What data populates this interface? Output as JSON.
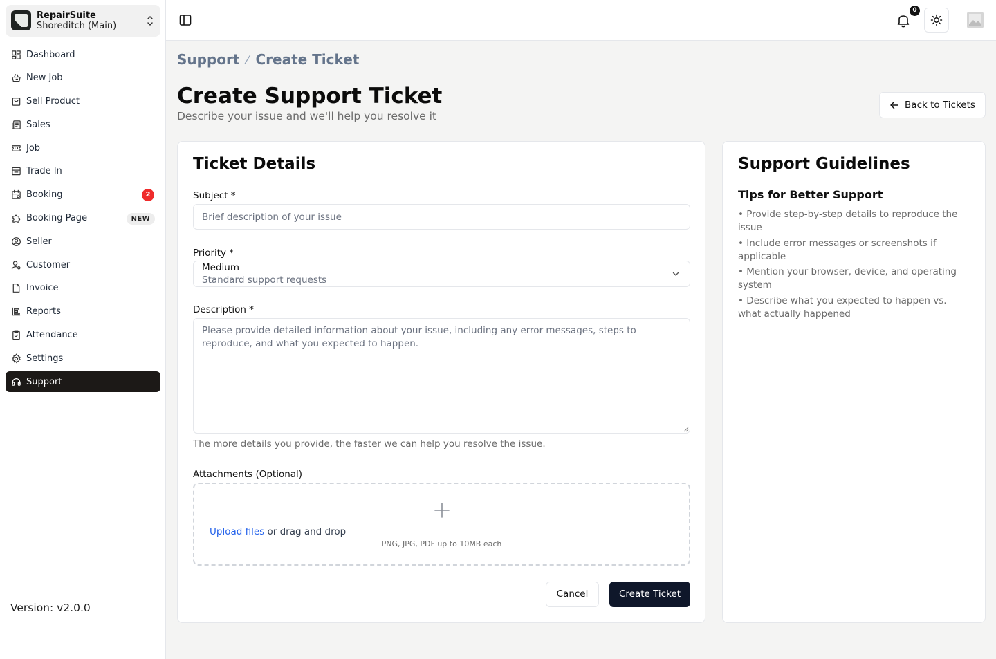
{
  "app": {
    "name": "RepairSuite",
    "branch": "Shoreditch (Main)"
  },
  "sidebar": {
    "items": [
      {
        "label": "Dashboard",
        "icon": "dashboard-icon"
      },
      {
        "label": "New Job",
        "icon": "basket-icon"
      },
      {
        "label": "Sell Product",
        "icon": "shopping-bag-icon"
      },
      {
        "label": "Sales",
        "icon": "receipt-icon"
      },
      {
        "label": "Job",
        "icon": "ticket-icon"
      },
      {
        "label": "Trade In",
        "icon": "archive-icon"
      },
      {
        "label": "Booking",
        "icon": "calendar-icon",
        "badge": "2"
      },
      {
        "label": "Booking Page",
        "icon": "puzzle-icon",
        "tag": "NEW"
      },
      {
        "label": "Seller",
        "icon": "user-circle-icon"
      },
      {
        "label": "Customer",
        "icon": "user-cog-icon"
      },
      {
        "label": "Invoice",
        "icon": "file-icon"
      },
      {
        "label": "Reports",
        "icon": "report-icon"
      },
      {
        "label": "Attendance",
        "icon": "clipboard-check-icon"
      },
      {
        "label": "Settings",
        "icon": "gear-icon"
      },
      {
        "label": "Support",
        "icon": "headset-icon",
        "active": true
      }
    ],
    "version": "Version: v2.0.0"
  },
  "topbar": {
    "notification_count": "0"
  },
  "breadcrumb": {
    "items": [
      "Support",
      "Create Ticket"
    ],
    "separator": "⁄"
  },
  "page": {
    "title": "Create Support Ticket",
    "subtitle": "Describe your issue and we'll help you resolve it",
    "back_label": "Back to Tickets"
  },
  "form": {
    "title": "Ticket Details",
    "subject_label": "Subject *",
    "subject_placeholder": "Brief description of your issue",
    "priority_label": "Priority *",
    "priority_value": "Medium",
    "priority_description": "Standard support requests",
    "description_label": "Description *",
    "description_placeholder": "Please provide detailed information about your issue, including any error messages, steps to reproduce, and what you expected to happen.",
    "description_hint": "The more details you provide, the faster we can help you resolve the issue.",
    "attachments_label": "Attachments (Optional)",
    "upload_link": "Upload files",
    "upload_text": " or drag and drop",
    "upload_note": "PNG, JPG, PDF up to 10MB each",
    "cancel_label": "Cancel",
    "submit_label": "Create Ticket"
  },
  "guidelines": {
    "title": "Support Guidelines",
    "subtitle": "Tips for Better Support",
    "tips": [
      "• Provide step-by-step details to reproduce the issue",
      "• Include error messages or screenshots if applicable",
      "• Mention your browser, device, and operating system",
      "• Describe what you expected to happen vs. what actually happened"
    ]
  },
  "colors": {
    "active_nav": "#1c1917",
    "primary_button": "#0f172a",
    "badge": "#ef2b2b",
    "link": "#2563eb"
  }
}
